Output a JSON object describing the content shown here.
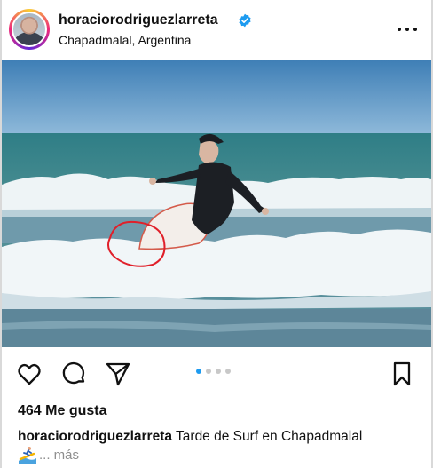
{
  "post": {
    "username": "horaciorodriguezlarreta",
    "location": "Chapadmalal, Argentina",
    "likes_text": "464 Me gusta",
    "caption_user": "horaciorodriguezlarreta",
    "caption_text": "Tarde de Surf en Chapadmalal",
    "caption_more": "... más",
    "carousel": {
      "count": 4,
      "active_index": 0
    }
  },
  "icons": {
    "verified": "verified-badge-icon",
    "more": "more-options-icon",
    "like": "heart-icon",
    "comment": "comment-icon",
    "share": "send-icon",
    "save": "bookmark-icon",
    "emoji": "surfer-emoji-icon"
  },
  "colors": {
    "verified_blue": "#1d9bf0",
    "active_dot": "#1d9bf0",
    "annotation_red": "#e0202a"
  }
}
